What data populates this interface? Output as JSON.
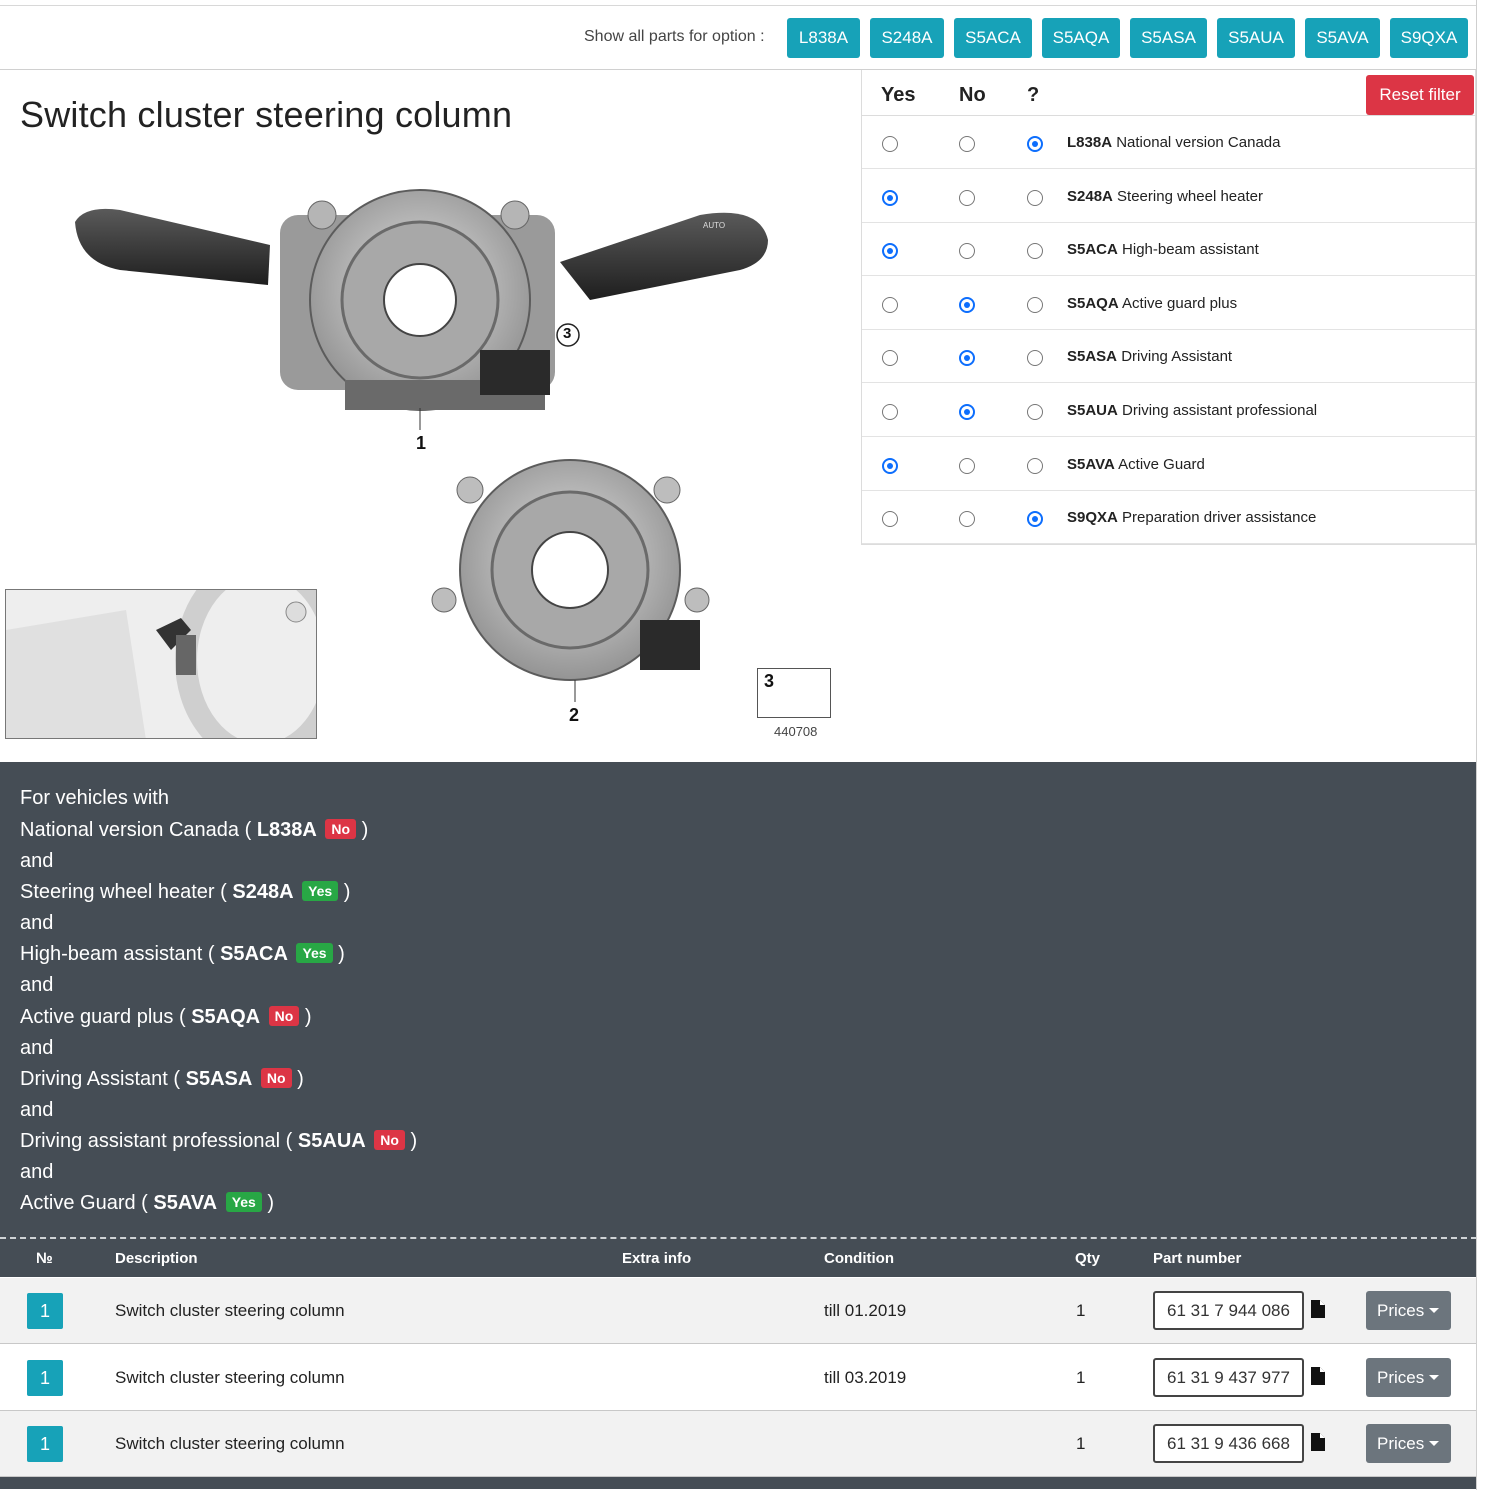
{
  "option_bar": {
    "label": "Show all parts for option :",
    "buttons": [
      "L838A",
      "S248A",
      "S5ACA",
      "S5AQA",
      "S5ASA",
      "S5AUA",
      "S5AVA",
      "S9QXA"
    ]
  },
  "title": "Switch cluster steering column",
  "diagram": {
    "callouts": [
      "1",
      "2",
      "3"
    ],
    "screw_label": "3",
    "screw_code": "440708",
    "stalk_text": "AUTO"
  },
  "filter": {
    "headers": {
      "yes": "Yes",
      "no": "No",
      "unknown": "?"
    },
    "reset_label": "Reset filter",
    "rows": [
      {
        "code": "L838A",
        "name": "National version Canada",
        "selected": "unknown"
      },
      {
        "code": "S248A",
        "name": "Steering wheel heater",
        "selected": "yes"
      },
      {
        "code": "S5ACA",
        "name": "High-beam assistant",
        "selected": "yes"
      },
      {
        "code": "S5AQA",
        "name": "Active guard plus",
        "selected": "no"
      },
      {
        "code": "S5ASA",
        "name": "Driving Assistant",
        "selected": "no"
      },
      {
        "code": "S5AUA",
        "name": "Driving assistant professional",
        "selected": "no"
      },
      {
        "code": "S5AVA",
        "name": "Active Guard",
        "selected": "yes"
      },
      {
        "code": "S9QXA",
        "name": "Preparation driver assistance",
        "selected": "unknown"
      }
    ]
  },
  "conditions": {
    "intro": "For vehicles with",
    "joiner": "and",
    "items": [
      {
        "name": "National version Canada",
        "code": "L838A",
        "value": "No"
      },
      {
        "name": "Steering wheel heater",
        "code": "S248A",
        "value": "Yes"
      },
      {
        "name": "High-beam assistant",
        "code": "S5ACA",
        "value": "Yes"
      },
      {
        "name": "Active guard plus",
        "code": "S5AQA",
        "value": "No"
      },
      {
        "name": "Driving Assistant",
        "code": "S5ASA",
        "value": "No"
      },
      {
        "name": "Driving assistant professional",
        "code": "S5AUA",
        "value": "No"
      },
      {
        "name": "Active Guard",
        "code": "S5AVA",
        "value": "Yes"
      }
    ]
  },
  "table": {
    "headers": {
      "no": "№",
      "description": "Description",
      "extra": "Extra info",
      "condition": "Condition",
      "qty": "Qty",
      "part": "Part number"
    },
    "rows": [
      {
        "no": "1",
        "description": "Switch cluster steering column",
        "extra": "",
        "condition": "till 01.2019",
        "qty": "1",
        "part": "61 31 7 944 086",
        "action": "Prices"
      },
      {
        "no": "1",
        "description": "Switch cluster steering column",
        "extra": "",
        "condition": "till 03.2019",
        "qty": "1",
        "part": "61 31 9 437 977",
        "action": "Prices"
      },
      {
        "no": "1",
        "description": "Switch cluster steering column",
        "extra": "",
        "condition": "",
        "qty": "1",
        "part": "61 31 9 436 668",
        "action": "Prices"
      }
    ]
  },
  "colors": {
    "teal": "#17a2b8",
    "red": "#dc3545",
    "green": "#28a745",
    "dark": "#454d55",
    "radio": "#0d6efd"
  }
}
